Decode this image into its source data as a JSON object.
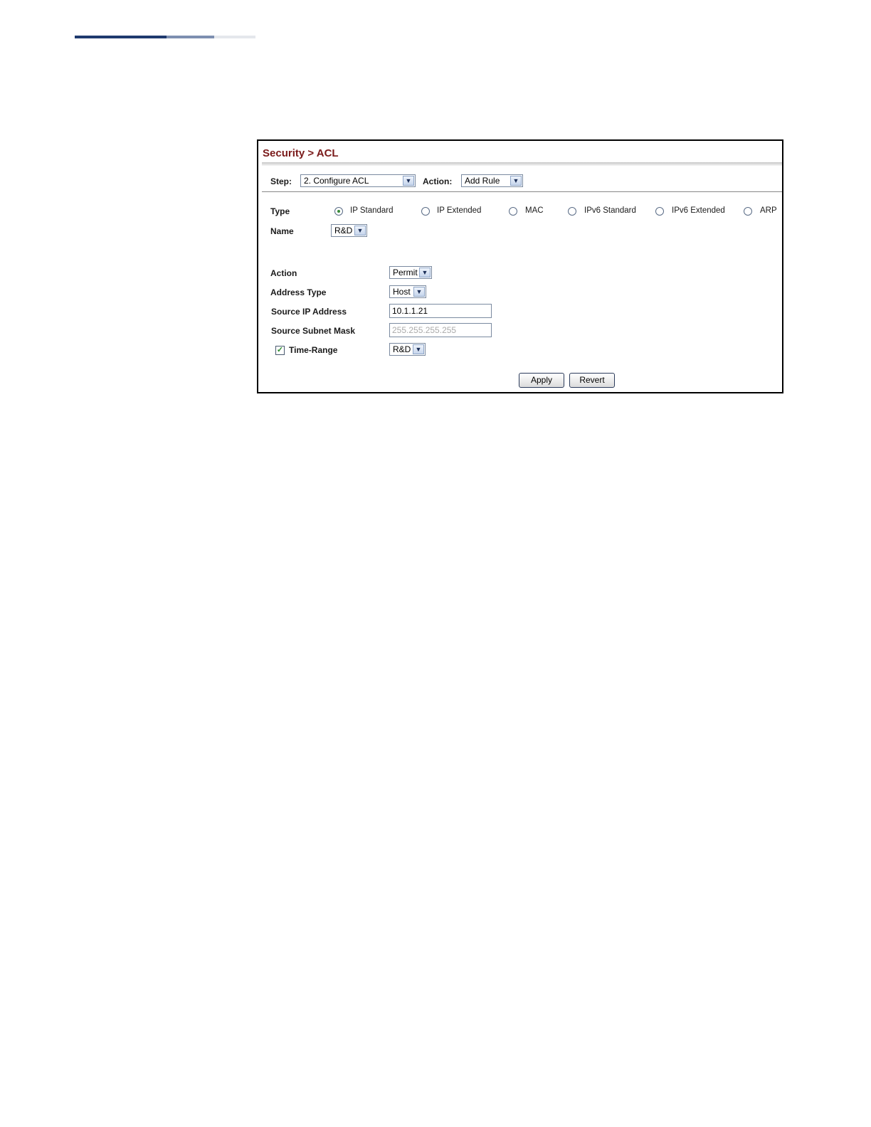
{
  "page": {
    "title": "Security > ACL"
  },
  "step_bar": {
    "step_label": "Step:",
    "step_value": "2. Configure ACL",
    "action_label": "Action:",
    "action_value": "Add Rule"
  },
  "form": {
    "type_label": "Type",
    "type_options": [
      {
        "label": "IP Standard",
        "checked": true
      },
      {
        "label": "IP Extended",
        "checked": false
      },
      {
        "label": "MAC",
        "checked": false
      },
      {
        "label": "IPv6 Standard",
        "checked": false
      },
      {
        "label": "IPv6 Extended",
        "checked": false
      },
      {
        "label": "ARP",
        "checked": false
      }
    ],
    "name_label": "Name",
    "name_value": "R&D",
    "action_label": "Action",
    "action_value": "Permit",
    "address_type_label": "Address Type",
    "address_type_value": "Host",
    "source_ip_label": "Source IP Address",
    "source_ip_value": "10.1.1.21",
    "source_mask_label": "Source Subnet Mask",
    "source_mask_value": "255.255.255.255",
    "time_range_label": "Time-Range",
    "time_range_checked": true,
    "time_range_value": "R&D"
  },
  "buttons": {
    "apply": "Apply",
    "revert": "Revert"
  },
  "icons": {
    "dropdown": "chevron-down-icon",
    "check": "checkmark-icon"
  },
  "colors": {
    "title": "#7a1a1a",
    "rule_dark": "#1f3a6e",
    "rule_mid": "#7d8fb0",
    "rule_light": "#e4e7ec",
    "radio_checked": "#3a8a3a"
  }
}
